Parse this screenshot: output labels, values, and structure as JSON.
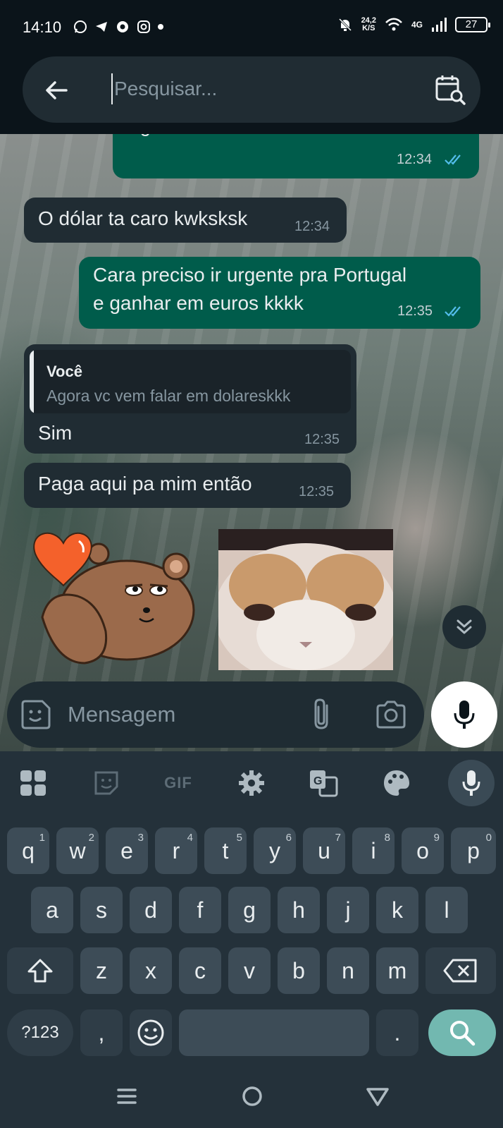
{
  "status_bar": {
    "time": "14:10",
    "speed_value": "24,2",
    "speed_unit": "K/S",
    "network": "4G",
    "battery": "27"
  },
  "search": {
    "placeholder": "Pesquisar..."
  },
  "messages": [
    {
      "direction": "out",
      "text": "Agora vc vem falar em dolareskkk",
      "time": "12:34",
      "read": true
    },
    {
      "direction": "in",
      "text": "O dólar ta caro kwksksk",
      "time": "12:34"
    },
    {
      "direction": "out",
      "text_line1": "Cara preciso ir urgente pra Portugal",
      "text_line2": "e ganhar em euros kkkk",
      "time": "12:35",
      "read": true
    },
    {
      "direction": "in",
      "quote_author": "Você",
      "quote_text": "Agora vc vem falar em dolareskkk",
      "text": "Sim",
      "time": "12:35"
    },
    {
      "direction": "in",
      "text": "Paga aqui pa mim então",
      "time": "12:35"
    }
  ],
  "composer": {
    "placeholder": "Mensagem"
  },
  "keyboard": {
    "toolbar_gif": "GIF",
    "row1": [
      {
        "k": "q",
        "n": "1"
      },
      {
        "k": "w",
        "n": "2"
      },
      {
        "k": "e",
        "n": "3"
      },
      {
        "k": "r",
        "n": "4"
      },
      {
        "k": "t",
        "n": "5"
      },
      {
        "k": "y",
        "n": "6"
      },
      {
        "k": "u",
        "n": "7"
      },
      {
        "k": "i",
        "n": "8"
      },
      {
        "k": "o",
        "n": "9"
      },
      {
        "k": "p",
        "n": "0"
      }
    ],
    "row2": [
      "a",
      "s",
      "d",
      "f",
      "g",
      "h",
      "j",
      "k",
      "l"
    ],
    "row3": [
      "z",
      "x",
      "c",
      "v",
      "b",
      "n",
      "m"
    ],
    "symbols": "?123",
    "comma": ",",
    "period": "."
  },
  "colors": {
    "outgoing": "#005c4b",
    "incoming": "#202c33",
    "read_ticks": "#53bdeb",
    "search_key": "#72b8b0"
  }
}
